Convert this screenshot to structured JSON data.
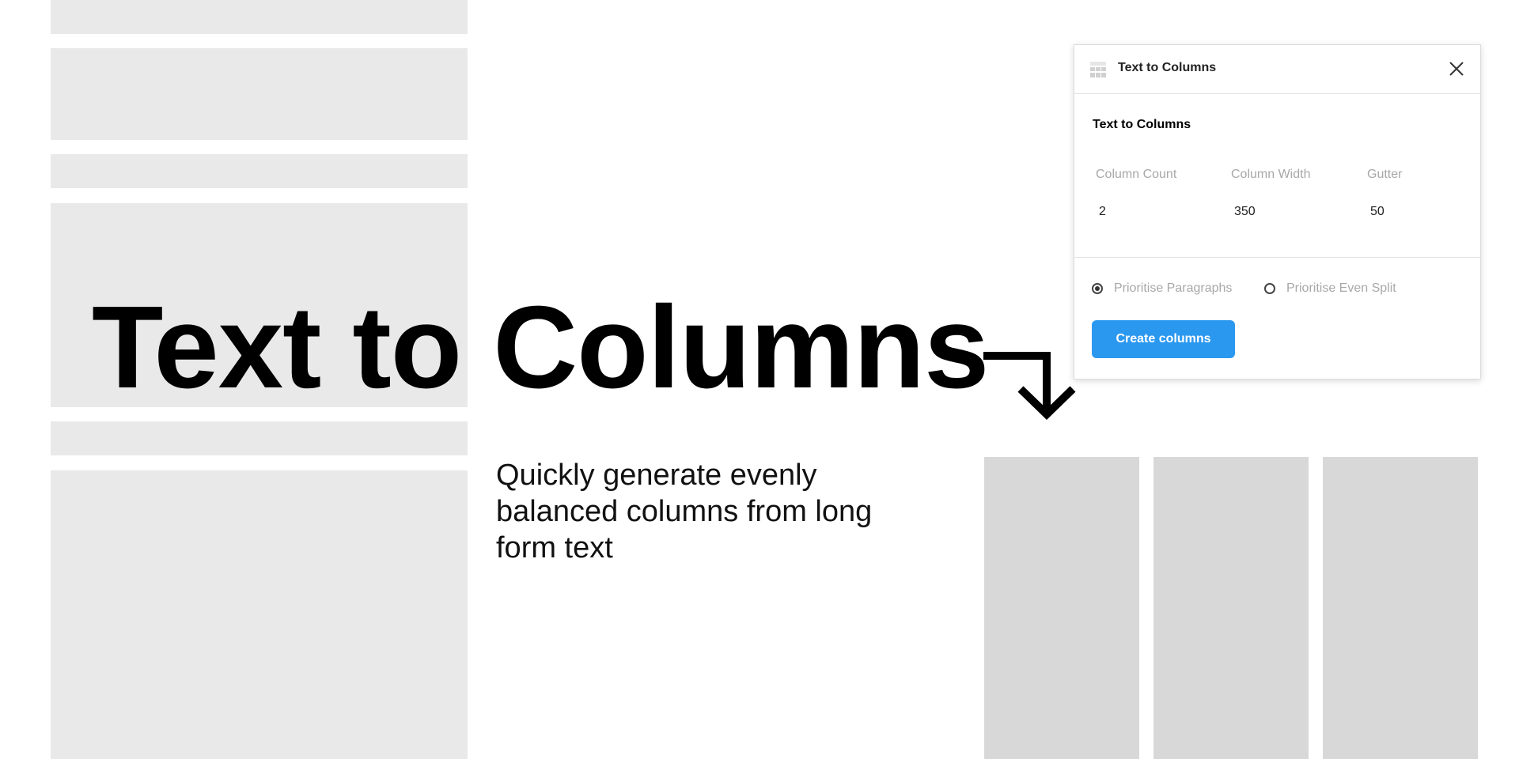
{
  "hero": {
    "title": "Text to Columns",
    "subtitle": "Quickly generate evenly balanced columns from long form text"
  },
  "panel": {
    "header_title": "Text to Columns",
    "header_icon": "table-icon",
    "close_icon": "close-icon",
    "section_title": "Text to Columns",
    "fields": [
      {
        "label": "Column Count",
        "value": "2"
      },
      {
        "label": "Column Width",
        "value": "350"
      },
      {
        "label": "Gutter",
        "value": "50"
      }
    ],
    "radios": [
      {
        "label": "Prioritise Paragraphs",
        "checked": true
      },
      {
        "label": "Prioritise Even Split",
        "checked": false
      }
    ],
    "create_button_label": "Create columns"
  },
  "colors": {
    "accent": "#2b98f0",
    "placeholder_light": "#e9e9e9",
    "placeholder_dark": "#d8d8d8"
  }
}
